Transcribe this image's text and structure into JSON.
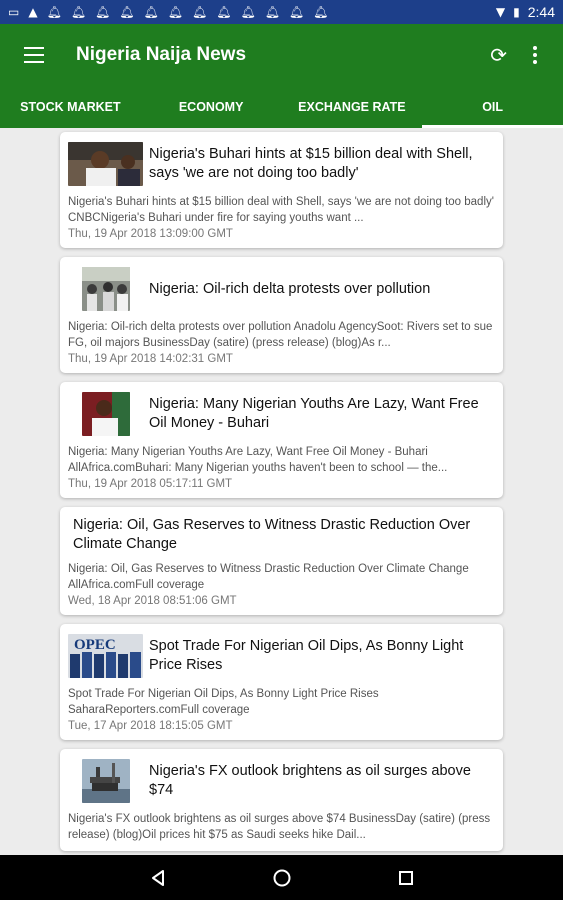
{
  "status_bar": {
    "time": "2:44",
    "icons": [
      "message-icon",
      "alert-icon",
      "notification-icon",
      "notification-icon",
      "notification-icon",
      "notification-icon",
      "notification-icon",
      "notification-icon",
      "notification-icon",
      "notification-icon",
      "notification-icon",
      "notification-icon",
      "notification-icon",
      "notification-icon"
    ]
  },
  "app_bar": {
    "title": "Nigeria Naija News",
    "background": "#1f7d1f"
  },
  "tabs": [
    {
      "label": "STOCK MARKET"
    },
    {
      "label": "ECONOMY"
    },
    {
      "label": "EXCHANGE RATE"
    },
    {
      "label": "OIL",
      "active": true
    }
  ],
  "articles": [
    {
      "title": "Nigeria's Buhari hints at $15 billion deal with Shell, says 'we are not doing too badly'",
      "description": "Nigeria's Buhari hints at $15 billion deal with Shell, says 'we are not doing too badly'  CNBCNigeria's Buhari under fire for saying youths want ...",
      "date": "Thu, 19 Apr 2018 13:09:00 GMT",
      "thumb": "wide"
    },
    {
      "title": "Nigeria: Oil-rich delta protests over pollution",
      "description": "Nigeria: Oil-rich delta protests over pollution  Anadolu AgencySoot: Rivers set to sue FG, oil majors  BusinessDay (satire) (press release) (blog)As r...",
      "date": "Thu, 19 Apr 2018 14:02:31 GMT",
      "thumb": "square"
    },
    {
      "title": "Nigeria: Many Nigerian Youths Are Lazy, Want Free Oil Money - Buhari",
      "description": "Nigeria: Many Nigerian Youths Are Lazy, Want Free Oil Money - Buhari  AllAfrica.comBuhari: Many Nigerian youths haven't been to school — the...",
      "date": "Thu, 19 Apr 2018 05:17:11 GMT",
      "thumb": "square"
    },
    {
      "title": "Nigeria: Oil, Gas Reserves to Witness Drastic Reduction Over Climate Change",
      "description": "Nigeria: Oil, Gas Reserves to Witness Drastic Reduction Over Climate Change  AllAfrica.comFull coverage",
      "date": "Wed, 18 Apr 2018 08:51:06 GMT",
      "thumb": "none"
    },
    {
      "title": "Spot Trade For Nigerian Oil Dips, As Bonny Light Price Rises",
      "description": "Spot Trade For Nigerian Oil Dips, As Bonny Light Price Rises  SaharaReporters.comFull coverage",
      "date": "Tue, 17 Apr 2018 18:15:05 GMT",
      "thumb": "wide",
      "thumb_text": "OPEC"
    },
    {
      "title": "Nigeria's FX outlook brightens as oil surges above $74",
      "description": "Nigeria's FX outlook brightens as oil surges above $74  BusinessDay (satire) (press release) (blog)Oil prices hit $75 as Saudi seeks hike  Dail...",
      "date": "",
      "thumb": "square"
    }
  ]
}
